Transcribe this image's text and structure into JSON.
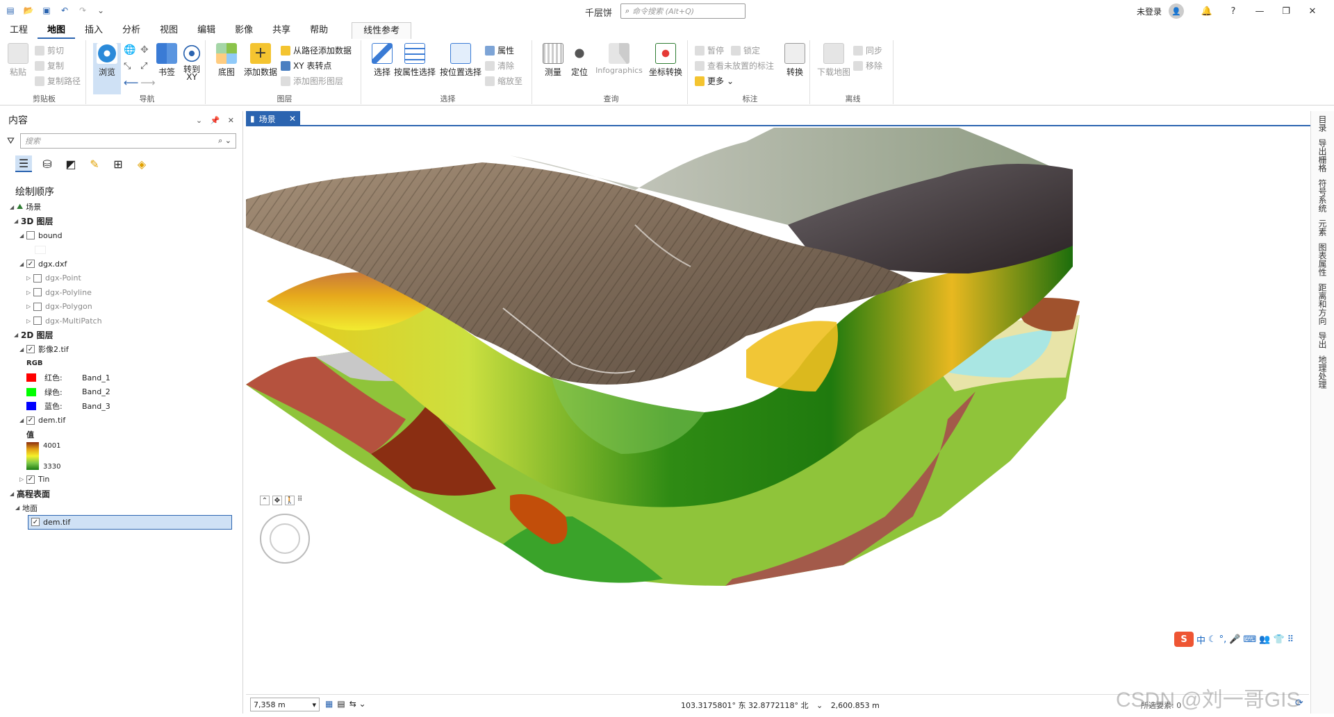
{
  "titlebar": {
    "app_title": "千层饼",
    "search_placeholder": "命令搜索 (Alt+Q)",
    "login": "未登录",
    "help": "?"
  },
  "tabs": [
    "工程",
    "地图",
    "插入",
    "分析",
    "视图",
    "编辑",
    "影像",
    "共享",
    "帮助"
  ],
  "active_tab": "地图",
  "context_tab": "线性参考",
  "ribbon": {
    "clipboard": {
      "label": "剪贴板",
      "paste": "粘贴",
      "cut": "剪切",
      "copy": "复制",
      "copy_path": "复制路径"
    },
    "navigate": {
      "label": "导航",
      "explore": "浏览",
      "bookmarks": "书签",
      "goto_xy": "转到\nXY"
    },
    "layer": {
      "label": "图层",
      "basemap": "底图",
      "add_data": "添加数据",
      "add_from_path": "从路径添加数据",
      "xy_to_point": "XY 表转点",
      "add_graphics": "添加图形图层"
    },
    "selection": {
      "label": "选择",
      "select": "选择",
      "select_by_attr": "按属性选择",
      "select_by_loc": "按位置选择",
      "attributes": "属性",
      "clear": "清除",
      "zoom_to": "缩放至"
    },
    "inquiry": {
      "label": "查询",
      "measure": "测量",
      "locate": "定位",
      "infographics": "Infographics",
      "coord_convert": "坐标转换"
    },
    "labeling": {
      "label": "标注",
      "pause": "暂停",
      "lock": "锁定",
      "unplaced": "查看未放置的标注",
      "more": "更多",
      "convert": "转换"
    },
    "offline": {
      "label": "离线",
      "download_map": "下载地图",
      "sync": "同步",
      "remove": "移除"
    }
  },
  "contents": {
    "title": "内容",
    "search_placeholder": "搜索",
    "draw_order": "绘制顺序",
    "tree": [
      {
        "label": "场景",
        "level": 0,
        "bold": false,
        "checkbox": false
      },
      {
        "label": "3D 图层",
        "level": 1,
        "bold": true,
        "checkbox": false
      },
      {
        "label": "bound",
        "level": 2,
        "checkbox": true,
        "checked": false
      },
      {
        "label": "",
        "level": 3,
        "spacer": true
      },
      {
        "label": "dgx.dxf",
        "level": 2,
        "checkbox": true,
        "checked": true
      },
      {
        "label": "dgx-Point",
        "level": 3,
        "checkbox": true,
        "checked": false
      },
      {
        "label": "dgx-Polyline",
        "level": 3,
        "checkbox": true,
        "checked": false
      },
      {
        "label": "dgx-Polygon",
        "level": 3,
        "checkbox": true,
        "checked": false
      },
      {
        "label": "dgx-MultiPatch",
        "level": 3,
        "checkbox": true,
        "checked": false
      },
      {
        "label": "2D 图层",
        "level": 1,
        "bold": true,
        "checkbox": false
      },
      {
        "label": "影像2.tif",
        "level": 2,
        "checkbox": true,
        "checked": true
      }
    ],
    "rgb": {
      "title": "RGB",
      "bands": [
        {
          "name": "红色:",
          "band": "Band_1",
          "color": "#ff0000"
        },
        {
          "name": "绿色:",
          "band": "Band_2",
          "color": "#00ff00"
        },
        {
          "name": "蓝色:",
          "band": "Band_3",
          "color": "#0000ff"
        }
      ]
    },
    "dem_layer": "dem.tif",
    "dem_legend": {
      "title": "值",
      "max": "4001",
      "min": "3330"
    },
    "tin": "Tin",
    "elevation_surfaces": "高程表面",
    "ground": "地面",
    "ground_dem": "dem.tif"
  },
  "view": {
    "tab_label": "场景"
  },
  "status": {
    "scale": "7,358 m",
    "coords": "103.3175801° 东 32.8772118° 北",
    "elevation": "2,600.853 m",
    "selected": "所选要素: 0"
  },
  "right_strip": [
    "目录",
    "导出栅格",
    "符号系统",
    "元素",
    "图表属性",
    "距离和方向",
    "导出",
    "地理处理"
  ],
  "ime": {
    "lang": "中"
  },
  "watermark": "CSDN @刘一哥GIS",
  "colors": {
    "accent": "#2b64b0",
    "selected_bg": "#cfe1f5"
  }
}
